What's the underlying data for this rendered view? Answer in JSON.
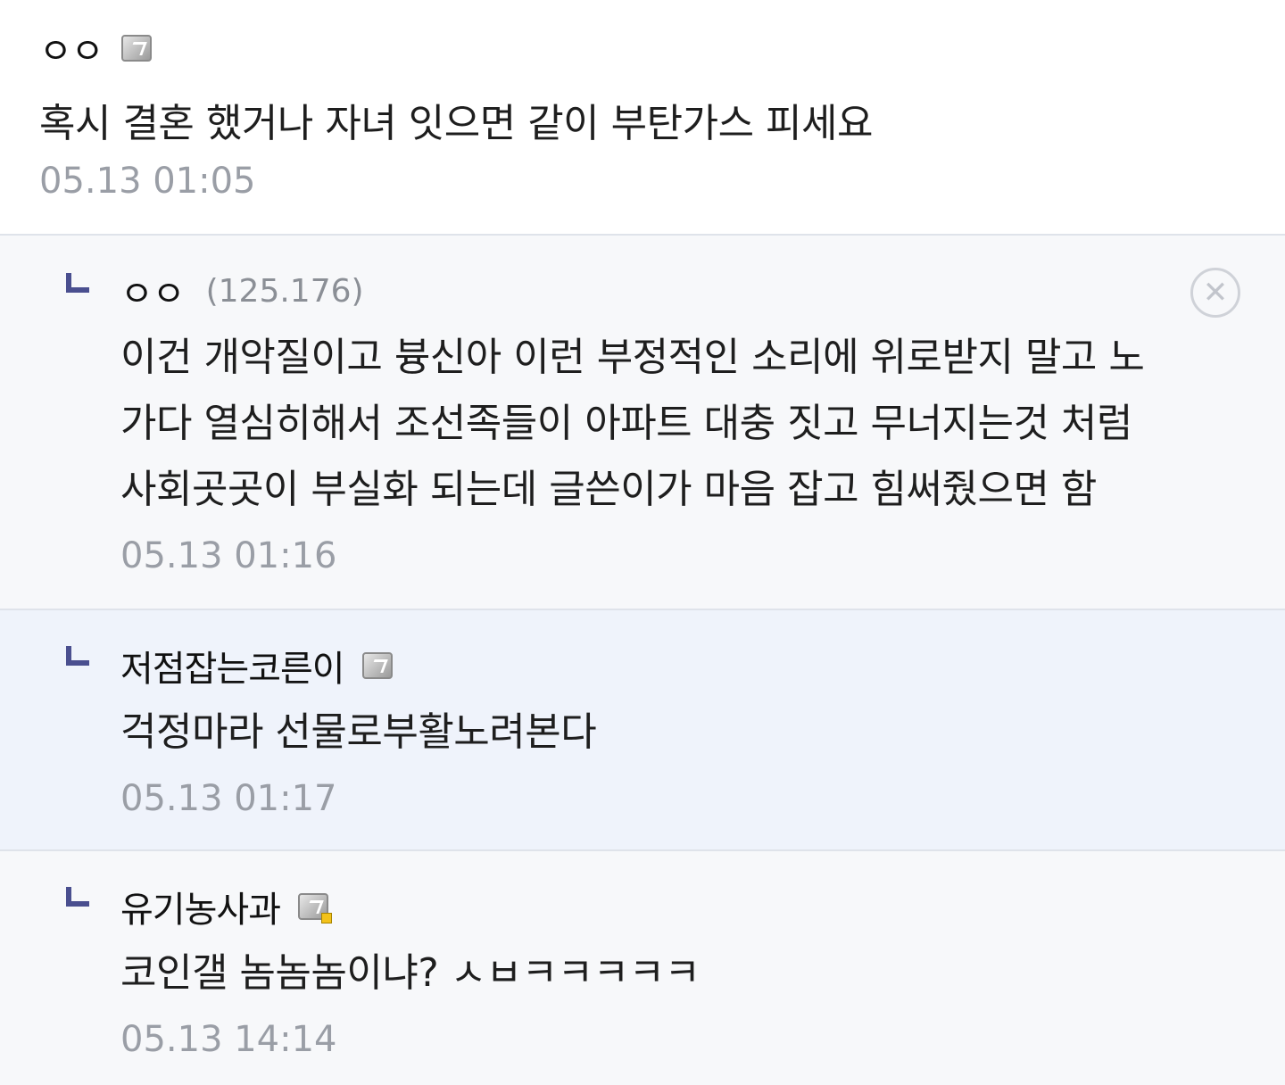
{
  "comments": [
    {
      "nickname": "ㅇㅇ",
      "text": "혹시 결혼 했거나 자녀 잇으면 같이 부탄가스 피세요",
      "time": "05.13 01:05",
      "member_icon": "member-badge-icon"
    }
  ],
  "replies": [
    {
      "nickname": "ㅇㅇ",
      "ip": "(125.176)",
      "lines": [
        "이건 개악질이고 븅신아 이런 부정적인 소리에 위로받지 말고 노",
        "가다 열심히해서 조선족들이 아파트 대충 짓고 무너지는것 처럼",
        "사회곳곳이 부실화 되는데 글쓴이가 마음 잡고 힘써줬으면 함"
      ],
      "time": "05.13 01:16",
      "delete_icon": "close-circle-icon"
    },
    {
      "nickname": "저점잡는코른이",
      "lines": [
        "걱정마라 선물로부활노려본다"
      ],
      "time": "05.13 01:17",
      "member_icon": "member-badge-icon"
    },
    {
      "nickname": "유기농사과",
      "lines": [
        "코인갤 놈놈놈이냐? ㅅㅂㅋㅋㅋㅋㅋ"
      ],
      "time": "05.13 14:14",
      "member_icon": "member-badge-dot-icon"
    }
  ],
  "colors": {
    "reply_arrow": "#4a4f8f",
    "highlight_bg": "#eff3fb",
    "time_text": "#9a9ea6"
  }
}
